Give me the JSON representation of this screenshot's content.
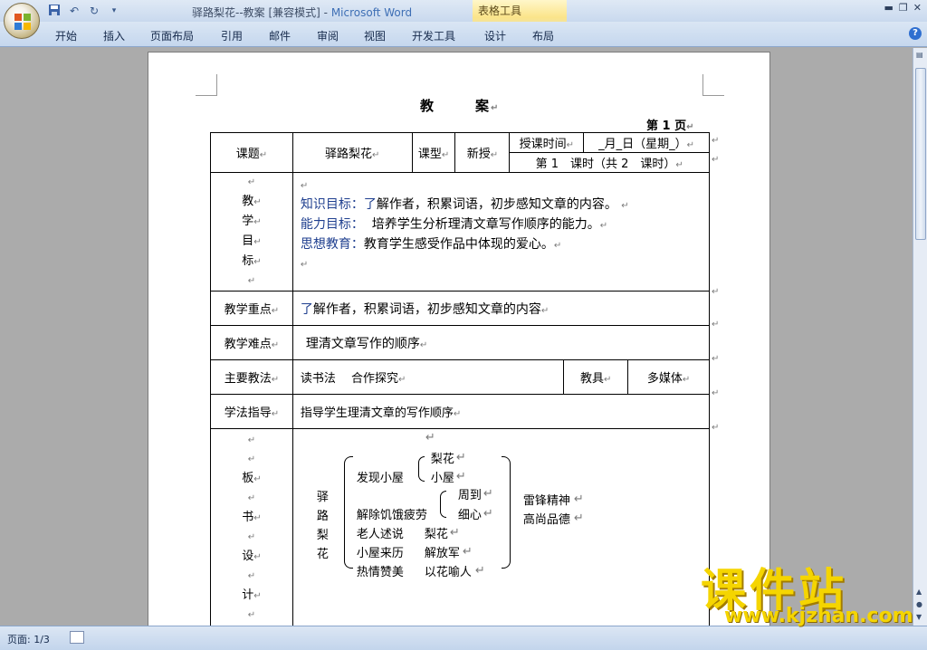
{
  "window": {
    "doc_name": "驿路梨花--教案 [兼容模式]",
    "separator": " - ",
    "app_name": "Microsoft Word",
    "context_group": "表格工具"
  },
  "ribbon": {
    "tabs": [
      "开始",
      "插入",
      "页面布局",
      "引用",
      "邮件",
      "审阅",
      "视图",
      "开发工具",
      "设计",
      "布局"
    ]
  },
  "document": {
    "title_a": "教",
    "title_b": "案",
    "page_label": "第 1 页",
    "header": {
      "topic_label": "课题",
      "topic": "驿路梨花",
      "type_label": "课型",
      "type": "新授",
      "time_label": "授课时间",
      "date": "_月_日（星期_）",
      "periods": "第 1　课时（共 2　课时）"
    },
    "goals": {
      "label_chars": [
        "教",
        "学",
        "目",
        "标"
      ],
      "knowledge_label": "知识目标",
      "knowledge_first": "了",
      "knowledge_text": "解作者，积累词语，初步感知文章的内容。",
      "ability_label": "能力目标",
      "ability_text": "培养学生分析理清文章写作顺序的能力。",
      "ideology_label": "思想教育",
      "ideology_text": "教育学生感受作品中体现的爱心。"
    },
    "key_point": {
      "label": "教学重点",
      "first": "了",
      "text": "解作者，积累词语，初步感知文章的内容"
    },
    "difficulty": {
      "label": "教学难点",
      "text": "理清文章写作的顺序"
    },
    "methods": {
      "label": "主要教法",
      "text": "读书法　 合作探究",
      "tools_label": "教具",
      "tools": "多媒体"
    },
    "study": {
      "label": "学法指导",
      "text": "指导学生理清文章的写作顺序"
    },
    "board": {
      "label_chars": [
        "板",
        "书",
        "设",
        "计"
      ],
      "root_chars": [
        "驿",
        "路",
        "梨",
        "花"
      ],
      "n1": "发现小屋",
      "n1a": "梨花",
      "n1b": "小屋",
      "n2": "解除饥饿疲劳",
      "n2a": "周到",
      "n2b": "细心",
      "n3": "老人述说",
      "n3a": "梨花",
      "n4": "小屋来历",
      "n4a": "解放军",
      "n5": "热情赞美",
      "n5a": "以花喻人",
      "right1": "雷锋精神",
      "right2": "高尚品德"
    }
  },
  "status": {
    "page_info": "页面: 1/3"
  },
  "watermark": {
    "brand": "课件站",
    "url": "www.kjzhan.com"
  }
}
